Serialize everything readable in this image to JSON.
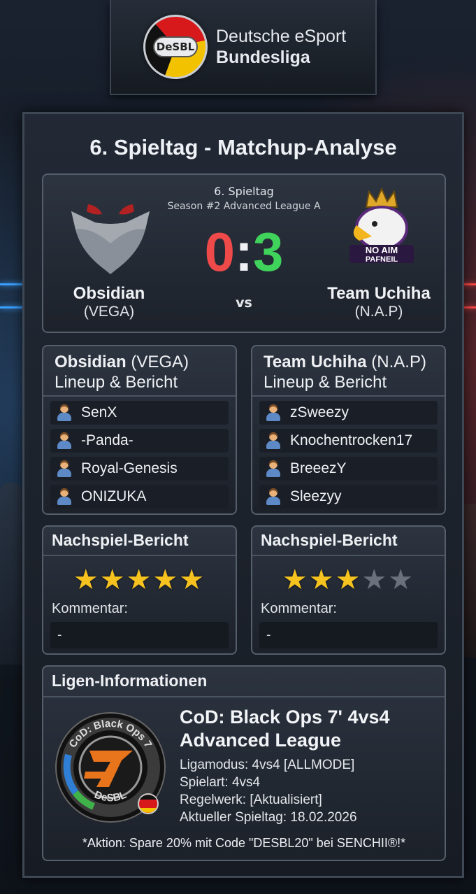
{
  "header": {
    "logo_text": "DeSBL",
    "title_line1": "Deutsche eSport",
    "title_line2": "Bundesliga"
  },
  "panel": {
    "title": "6. Spieltag - Matchup-Analyse"
  },
  "match": {
    "round": "6. Spieltag",
    "season": "Season #2 Advanced League A",
    "score_home": "0",
    "score_separator": ":",
    "score_away": "3",
    "vs_label": "vs",
    "home": {
      "name": "Obsidian",
      "tag": "(VEGA)"
    },
    "away": {
      "name": "Team Uchiha",
      "tag": "(N.A.P)",
      "emblem_text": "NO AIM PAFNEIL"
    }
  },
  "lineups": {
    "home": {
      "team_name": "Obsidian",
      "team_tag": "(VEGA)",
      "subtitle": "Lineup & Bericht",
      "players": [
        "SenX",
        "-Panda-",
        "Royal-Genesis",
        "ONIZUKA"
      ]
    },
    "away": {
      "team_name": "Team Uchiha",
      "team_tag": "(N.A.P)",
      "subtitle": "Lineup & Bericht",
      "players": [
        "zSweezy",
        "Knochentrocken17",
        "BreeezY",
        "Sleezyy"
      ]
    }
  },
  "reports": {
    "home": {
      "title": "Nachspiel-Bericht",
      "rating": 5,
      "rating_max": 5,
      "comment_label": "Kommentar:",
      "comment": "-"
    },
    "away": {
      "title": "Nachspiel-Bericht",
      "rating": 3,
      "rating_max": 5,
      "comment_label": "Kommentar:",
      "comment": "-"
    }
  },
  "league": {
    "header": "Ligen-Informationen",
    "emblem_ring_text": "CoD: Black Ops 7",
    "emblem_bottom_text": "DeSBL",
    "title_line1": "CoD: Black Ops 7' 4vs4",
    "title_line2": "Advanced League",
    "facts": [
      "Ligamodus: 4vs4 [ALLMODE]",
      "Spielart: 4vs4",
      "Regelwerk: [Aktualisiert]",
      "Aktueller Spieltag: 18.02.2026"
    ],
    "promo": "*Aktion: Spare 20% mit Code \"DESBL20\" bei SENCHII®!*"
  },
  "colors": {
    "score_home": "#ef4a4a",
    "score_away": "#3fd35c",
    "star_on": "#f5c220",
    "star_off": "#6a717c"
  },
  "icons": {
    "player": "player-avatar-icon",
    "star": "star-icon"
  }
}
